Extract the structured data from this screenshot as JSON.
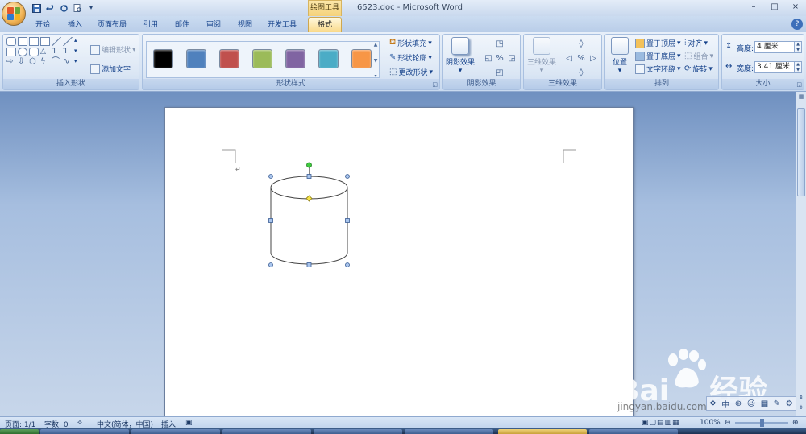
{
  "window": {
    "title": "6523.doc - Microsoft Word",
    "context_tab_group": "绘图工具",
    "controls": [
      "–",
      "□",
      "×"
    ]
  },
  "quick_access": [
    "save-icon",
    "undo-icon",
    "redo-icon",
    "print-preview-icon",
    "customize-icon"
  ],
  "tabs": [
    "开始",
    "插入",
    "页面布局",
    "引用",
    "邮件",
    "审阅",
    "视图",
    "开发工具",
    "格式"
  ],
  "active_tab": "格式",
  "ribbon": {
    "insert_shapes": {
      "label": "插入形状",
      "edit_shape": "编辑形状",
      "add_text": "添加文字"
    },
    "shape_styles": {
      "label": "形状样式",
      "swatches": [
        "#000000",
        "#4f81bd",
        "#c0504d",
        "#9bbb59",
        "#8064a2",
        "#4bacc6",
        "#f79646"
      ],
      "fill": "形状填充",
      "outline": "形状轮廓",
      "change_shape": "更改形状"
    },
    "shadow": {
      "label": "阴影效果",
      "button": "阴影效果"
    },
    "threed": {
      "label": "三维效果",
      "button": "三维效果"
    },
    "arrange": {
      "label": "排列",
      "position": "位置",
      "bring_front": "置于顶层",
      "send_back": "置于底层",
      "text_wrap": "文字环绕",
      "align": "对齐",
      "group": "组合",
      "rotate": "旋转"
    },
    "size": {
      "label": "大小",
      "height_label": "高度:",
      "height_value": "4 厘米",
      "width_label": "宽度:",
      "width_value": "3.41 厘米"
    }
  },
  "document": {
    "paragraph_mark": "↵",
    "shape": "cylinder"
  },
  "status_bar": {
    "page": "页面: 1/1",
    "words": "字数: 0",
    "language": "中文(简体，中国)",
    "mode": "插入",
    "zoom": "100%"
  },
  "watermark": {
    "brand": "Bai",
    "brand_cn": "经验",
    "url": "jingyan.baidu.com"
  }
}
